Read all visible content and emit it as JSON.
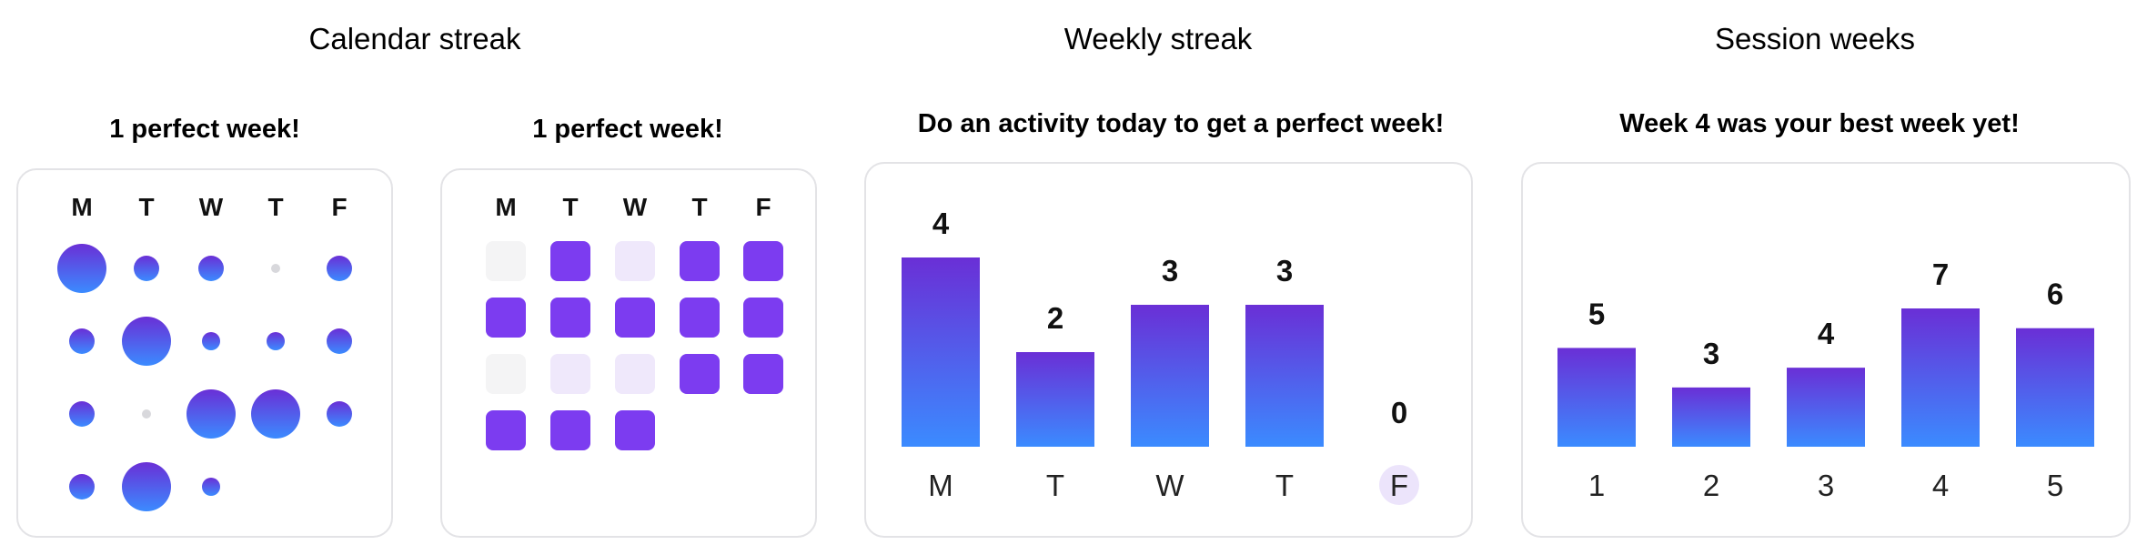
{
  "colors": {
    "gradient_top": "#6a2fd6",
    "gradient_bottom": "#3b8bff",
    "active_square": "#7c3cf0",
    "light_square": "#efe8fb",
    "empty_square": "#f4f4f5",
    "tiny_dot": "#d8d8dc",
    "highlight_circle": "#ece4fb",
    "card_border": "#e3e3e6"
  },
  "calendar_streak": {
    "title": "Calendar streak",
    "subtitle": "1 perfect week!",
    "days": [
      "M",
      "T",
      "W",
      "T",
      "F"
    ],
    "rows": [
      [
        "large",
        "small",
        "small",
        "none",
        "small"
      ],
      [
        "small",
        "large",
        "tiny",
        "tiny",
        "small"
      ],
      [
        "small",
        "none",
        "large",
        "large",
        "small"
      ],
      [
        "small",
        "large",
        "tiny"
      ]
    ]
  },
  "calendar_streak_grid": {
    "subtitle": "1 perfect week!",
    "days": [
      "M",
      "T",
      "W",
      "T",
      "F"
    ],
    "rows": [
      [
        "empty",
        "active",
        "light",
        "active",
        "active"
      ],
      [
        "active",
        "active",
        "active",
        "active",
        "active"
      ],
      [
        "empty",
        "light",
        "light",
        "active",
        "active"
      ],
      [
        "active",
        "active",
        "active"
      ]
    ]
  },
  "weekly_streak": {
    "title": "Weekly streak",
    "subtitle": "Do an activity today to get a perfect week!",
    "highlighted_category": "F"
  },
  "session_weeks": {
    "title": "Session weeks",
    "subtitle": "Week 4 was your best week yet!",
    "highlighted_category": ""
  },
  "chart_data": [
    {
      "type": "bar",
      "categories": [
        "M",
        "T",
        "W",
        "T",
        "F"
      ],
      "values": [
        4,
        2,
        3,
        3,
        0
      ],
      "ylim": [
        0,
        4
      ]
    },
    {
      "type": "bar",
      "categories": [
        "1",
        "2",
        "3",
        "4",
        "5"
      ],
      "values": [
        5,
        3,
        4,
        7,
        6
      ],
      "ylim": [
        0,
        7
      ]
    }
  ]
}
